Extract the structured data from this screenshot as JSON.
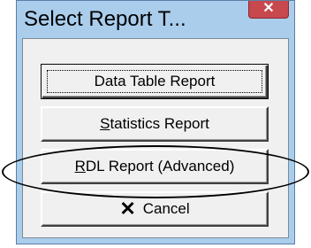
{
  "dialog": {
    "title": "Select Report T...",
    "close_glyph": "✕"
  },
  "buttons": [
    {
      "label": "Data Table Report",
      "default": true
    },
    {
      "label_html": "<u>S</u>tatistics Report",
      "label": "Statistics Report"
    },
    {
      "label_html": "<u>R</u>DL Report (Advanced)",
      "label": "RDL Report (Advanced)"
    },
    {
      "label": "Cancel",
      "icon": "close-x-icon"
    }
  ],
  "annotation": {
    "type": "ellipse",
    "color": "#000000",
    "highlights": "RDL Report (Advanced)"
  },
  "colors": {
    "titlebar": "#aacdec",
    "close_button": "#c7484d",
    "client": "#f0f0f0"
  }
}
